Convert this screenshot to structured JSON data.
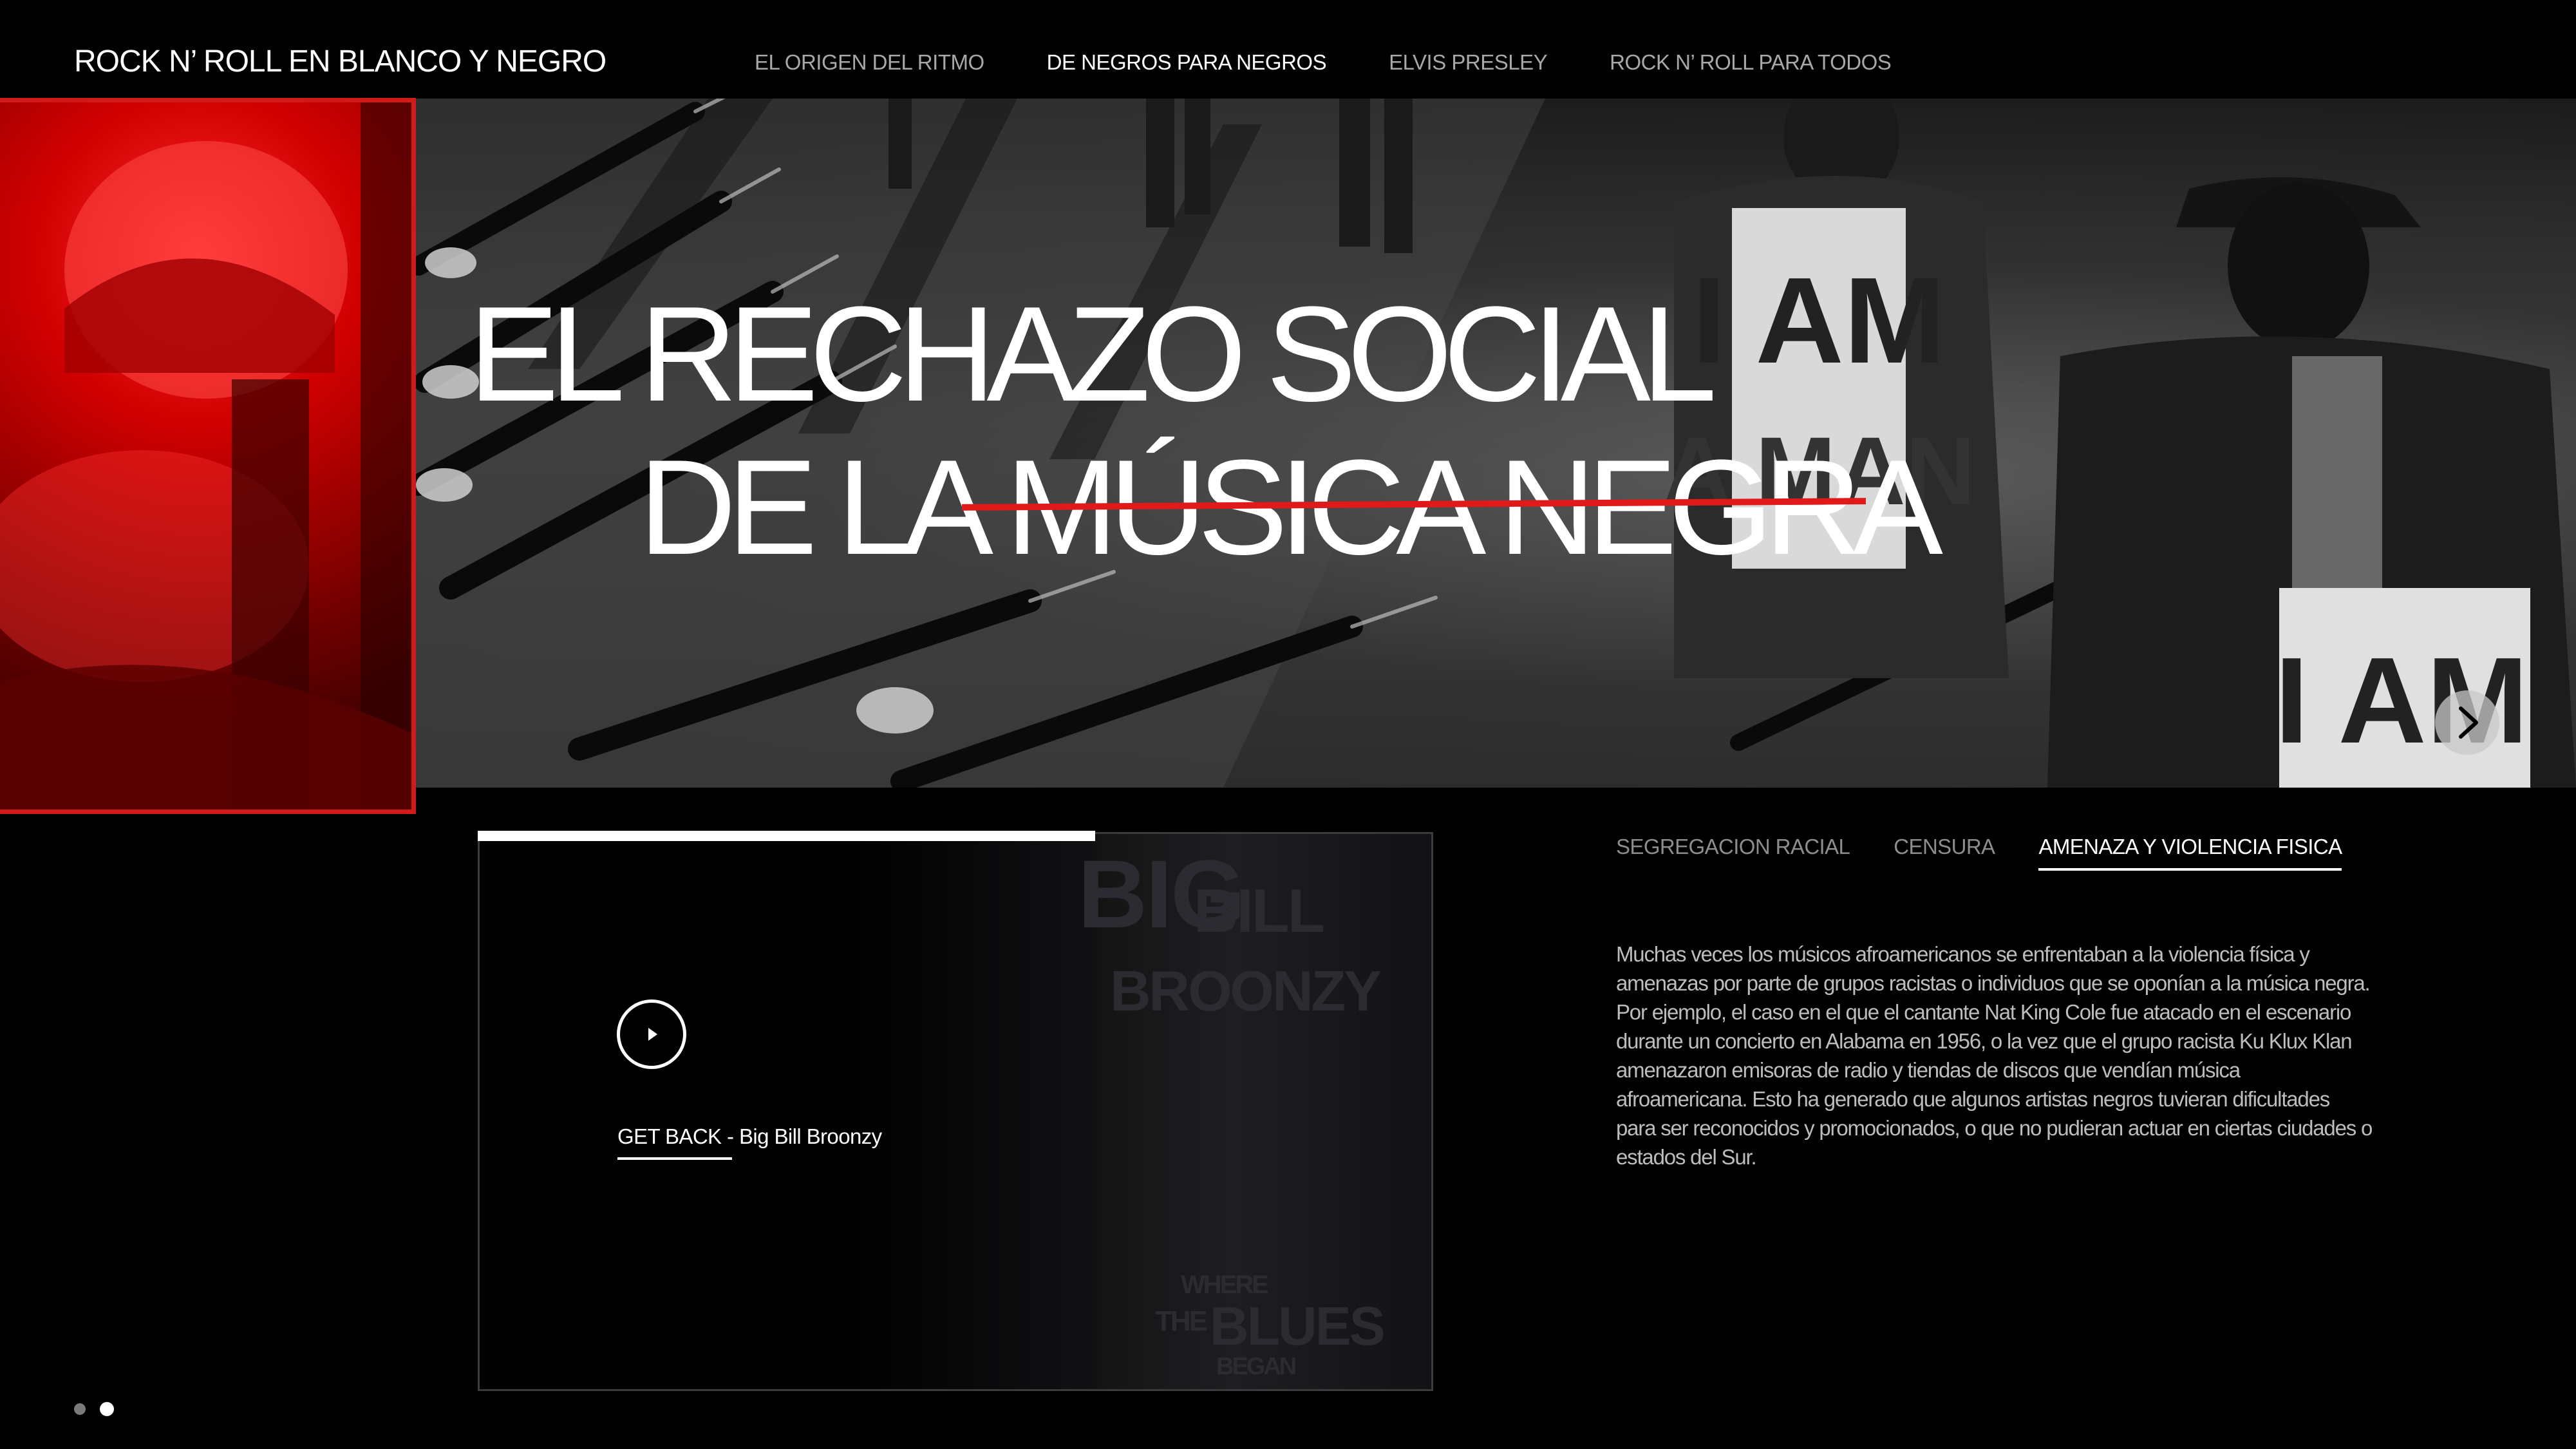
{
  "header": {
    "site_title": "ROCK N’ ROLL EN BLANCO Y NEGRO",
    "nav": [
      {
        "label": "EL ORIGEN DEL RITMO",
        "active": false
      },
      {
        "label": "DE NEGROS PARA NEGROS",
        "active": true
      },
      {
        "label": "ELVIS PRESLEY",
        "active": false
      },
      {
        "label": "ROCK N’ ROLL PARA TODOS",
        "active": false
      }
    ]
  },
  "hero": {
    "title_line1": "EL RECHAZO SOCIAL",
    "title_line2": "DE LA MÚSICA NEGRA",
    "sign_text_1": "I AM",
    "sign_text_2": "A MAN",
    "sign_text_3": "I AM",
    "next_icon": "chevron-right-icon"
  },
  "media": {
    "progress": 0.646,
    "track_title": "GET BACK - Big Bill Broonzy",
    "album_art_text_1": "BIG",
    "album_art_text_2": "BILL",
    "album_art_text_3": "BROONZY",
    "album_art_text_4": "WHERE",
    "album_art_text_5": "THE",
    "album_art_text_6": "BLUES",
    "album_art_text_7": "BEGAN",
    "play_icon": "play-icon"
  },
  "tabs": [
    {
      "label": "SEGREGACION RACIAL",
      "active": false
    },
    {
      "label": "CENSURA",
      "active": false
    },
    {
      "label": "AMENAZA Y VIOLENCIA FISICA",
      "active": true
    }
  ],
  "content": {
    "body": "Muchas veces los músicos afroamericanos se enfrentaban a la violencia física y amenazas por parte de grupos racistas o individuos que se oponían a la música negra. Por ejemplo, el caso en el que el cantante Nat King Cole fue atacado en el escenario durante un concierto en Alabama en 1956,  o la vez que el grupo racista Ku Klux Klan amenazaron emisoras de radio y tiendas de discos que vendían música afroamericana. Esto ha generado que algunos artistas negros tuvieran dificultades para ser reconocidos y promocionados, o que no pudieran actuar en ciertas ciudades o estados del Sur."
  },
  "pager": {
    "total": 2,
    "current": 2
  },
  "colors": {
    "accent_red": "#e01a1a",
    "background": "#000000",
    "text": "#ffffff",
    "muted": "#a8a8a8"
  }
}
